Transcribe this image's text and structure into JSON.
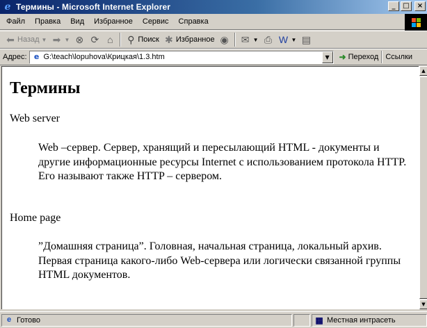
{
  "window": {
    "title": "Термины - Microsoft Internet Explorer",
    "logo_icon": "e",
    "min_glyph": "_",
    "max_glyph": "□",
    "close_glyph": "×"
  },
  "menu": [
    "Файл",
    "Правка",
    "Вид",
    "Избранное",
    "Сервис",
    "Справка"
  ],
  "toolbar": {
    "back_label": "Назад",
    "search_label": "Поиск",
    "favorites_label": "Избранное"
  },
  "address": {
    "label": "Адрес:",
    "value": "G:\\teach\\lopuhova\\Крицкая\\1.3.htm",
    "go_label": "Переход",
    "links_label": "Ссылки"
  },
  "page": {
    "heading": "Термины",
    "terms": [
      {
        "term": "Web server",
        "definition": "Web –сервер. Сервер, хранящий и пересылающий HTML - документы и другие информационные ресурсы Internet с использованием протокола HTTP. Его называют также HTTP – сервером."
      },
      {
        "term": "Home page",
        "definition": "”Домашняя страница”. Головная, начальная страница, локальный архив. Первая страница какого-либо Web-сервера или логически связанной группы HTML документов."
      }
    ]
  },
  "status": {
    "text": "Готово",
    "zone": "Местная интрасеть"
  },
  "colors": {
    "title_gradient_start": "#0a246a",
    "title_gradient_end": "#a6caf0",
    "chrome": "#d4d0c8"
  }
}
